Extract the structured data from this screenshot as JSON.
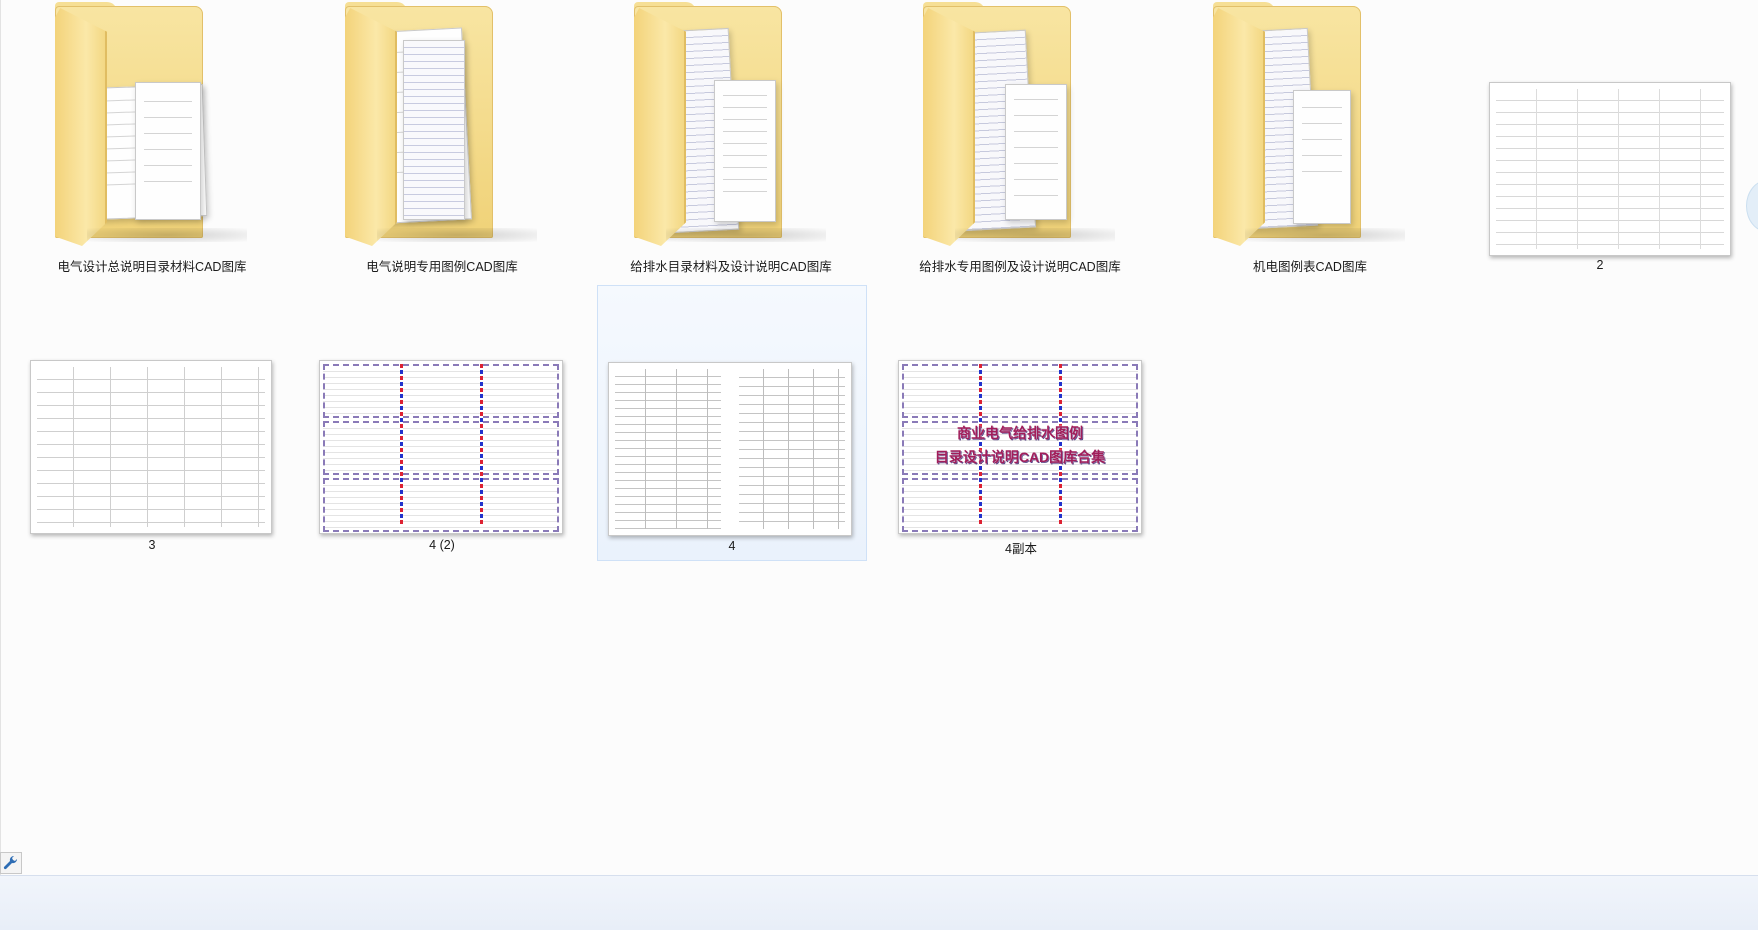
{
  "window": {
    "title": ""
  },
  "items": [
    {
      "type": "folder",
      "label": "电气设计总说明目录材料CAD图库"
    },
    {
      "type": "folder",
      "label": "电气说明专用图例CAD图库"
    },
    {
      "type": "folder",
      "label": "给排水目录材料及设计说明CAD图库"
    },
    {
      "type": "folder",
      "label": "给排水专用图例及设计说明CAD图库"
    },
    {
      "type": "folder",
      "label": "机电图例表CAD图库"
    },
    {
      "type": "image",
      "label": "2"
    },
    {
      "type": "image",
      "label": "3"
    },
    {
      "type": "image",
      "label": "4 (2)"
    },
    {
      "type": "image",
      "label": "4",
      "selected": true
    },
    {
      "type": "image",
      "label": "4副本",
      "overlay_lines": [
        "商业电气给排水图例",
        "目录设计说明CAD图库合集"
      ]
    }
  ],
  "icons": {
    "settings": "wrench-icon"
  },
  "colors": {
    "selection_bg": "#eaf2fc",
    "selection_border": "#cfe1f7",
    "folder": "#f6df95",
    "statusbar": "#e8eef8"
  }
}
